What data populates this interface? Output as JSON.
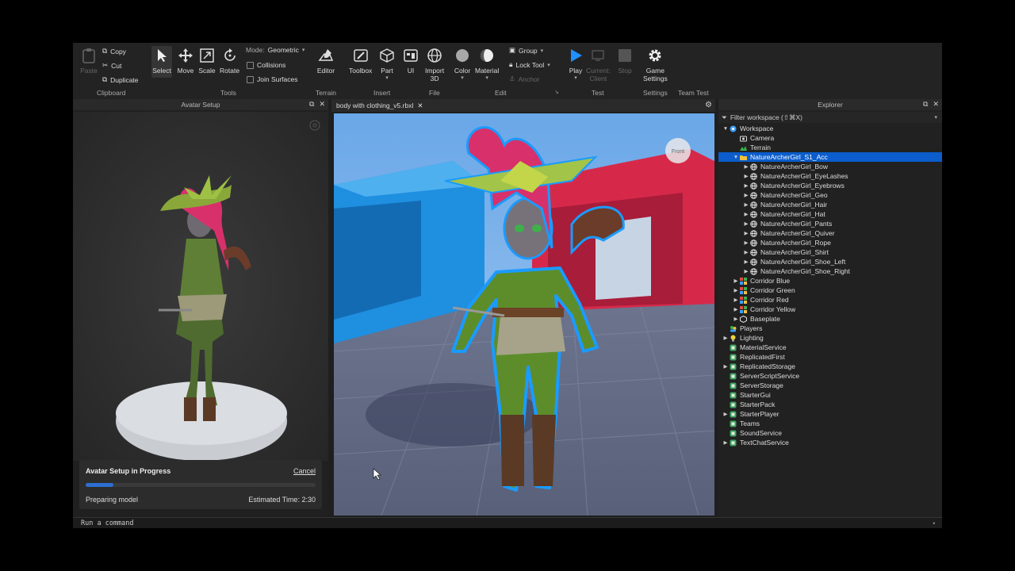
{
  "ribbon": {
    "clipboard": {
      "paste": "Paste",
      "copy": "Copy",
      "cut": "Cut",
      "duplicate": "Duplicate",
      "group": "Clipboard"
    },
    "tools": {
      "select": "Select",
      "move": "Move",
      "scale": "Scale",
      "rotate": "Rotate",
      "mode_label": "Mode:",
      "mode_value": "Geometric",
      "collisions": "Collisions",
      "join_surfaces": "Join Surfaces",
      "group": "Tools"
    },
    "terrain": {
      "editor": "Editor",
      "group": "Terrain"
    },
    "insert": {
      "toolbox": "Toolbox",
      "part": "Part",
      "ui": "UI",
      "group": "Insert"
    },
    "file": {
      "import": "Import",
      "import2": "3D",
      "group": "File"
    },
    "edit": {
      "color": "Color",
      "material": "Material",
      "group_btn": "Group",
      "lock_tool": "Lock Tool",
      "anchor": "Anchor",
      "group": "Edit"
    },
    "test": {
      "play": "Play",
      "current": "Current:",
      "client": "Client",
      "stop": "Stop",
      "group": "Test"
    },
    "settings": {
      "game": "Game",
      "settings": "Settings",
      "group": "Settings"
    },
    "team_test": {
      "group": "Team Test"
    },
    "colors": {
      "accent": "#1e90ff",
      "selection": "#0b5dcb"
    }
  },
  "avatar_setup": {
    "title": "Avatar Setup",
    "progress_title": "Avatar Setup in Progress",
    "cancel": "Cancel",
    "progress": 0.12,
    "status": "Preparing model",
    "eta_label": "Estimated Time:",
    "eta_value": "2:30"
  },
  "viewport": {
    "tab": "body with clothing_v5.rbxl",
    "view_cube": "Front"
  },
  "explorer": {
    "title": "Explorer",
    "filter": "Filter workspace (⇧⌘X)",
    "items": [
      {
        "label": "Workspace",
        "depth": 0,
        "arrow": "down",
        "icon": "workspace"
      },
      {
        "label": "Camera",
        "depth": 1,
        "arrow": "",
        "icon": "camera"
      },
      {
        "label": "Terrain",
        "depth": 1,
        "arrow": "",
        "icon": "terrain"
      },
      {
        "label": "NatureArcherGirl_S1_Acc",
        "depth": 1,
        "arrow": "down",
        "icon": "folder",
        "selected": true
      },
      {
        "label": "NatureArcherGirl_Bow",
        "depth": 2,
        "arrow": "right",
        "icon": "mesh"
      },
      {
        "label": "NatureArcherGirl_EyeLashes",
        "depth": 2,
        "arrow": "right",
        "icon": "mesh"
      },
      {
        "label": "NatureArcherGirl_Eyebrows",
        "depth": 2,
        "arrow": "right",
        "icon": "mesh"
      },
      {
        "label": "NatureArcherGirl_Geo",
        "depth": 2,
        "arrow": "right",
        "icon": "mesh"
      },
      {
        "label": "NatureArcherGirl_Hair",
        "depth": 2,
        "arrow": "right",
        "icon": "mesh"
      },
      {
        "label": "NatureArcherGirl_Hat",
        "depth": 2,
        "arrow": "right",
        "icon": "mesh"
      },
      {
        "label": "NatureArcherGirl_Pants",
        "depth": 2,
        "arrow": "right",
        "icon": "mesh"
      },
      {
        "label": "NatureArcherGirl_Quiver",
        "depth": 2,
        "arrow": "right",
        "icon": "mesh"
      },
      {
        "label": "NatureArcherGirl_Rope",
        "depth": 2,
        "arrow": "right",
        "icon": "mesh"
      },
      {
        "label": "NatureArcherGirl_Shirt",
        "depth": 2,
        "arrow": "right",
        "icon": "mesh"
      },
      {
        "label": "NatureArcherGirl_Shoe_Left",
        "depth": 2,
        "arrow": "right",
        "icon": "mesh"
      },
      {
        "label": "NatureArcherGirl_Shoe_Right",
        "depth": 2,
        "arrow": "right",
        "icon": "mesh"
      },
      {
        "label": "Corridor Blue",
        "depth": 1,
        "arrow": "right",
        "icon": "model"
      },
      {
        "label": "Corridor Green",
        "depth": 1,
        "arrow": "right",
        "icon": "model"
      },
      {
        "label": "Corridor Red",
        "depth": 1,
        "arrow": "right",
        "icon": "model"
      },
      {
        "label": "Corridor Yellow",
        "depth": 1,
        "arrow": "right",
        "icon": "model"
      },
      {
        "label": "Baseplate",
        "depth": 1,
        "arrow": "right",
        "icon": "part"
      },
      {
        "label": "Players",
        "depth": 0,
        "arrow": "",
        "icon": "players"
      },
      {
        "label": "Lighting",
        "depth": 0,
        "arrow": "right",
        "icon": "lighting"
      },
      {
        "label": "MaterialService",
        "depth": 0,
        "arrow": "",
        "icon": "service"
      },
      {
        "label": "ReplicatedFirst",
        "depth": 0,
        "arrow": "",
        "icon": "service"
      },
      {
        "label": "ReplicatedStorage",
        "depth": 0,
        "arrow": "right",
        "icon": "service"
      },
      {
        "label": "ServerScriptService",
        "depth": 0,
        "arrow": "",
        "icon": "service"
      },
      {
        "label": "ServerStorage",
        "depth": 0,
        "arrow": "",
        "icon": "service"
      },
      {
        "label": "StarterGui",
        "depth": 0,
        "arrow": "",
        "icon": "service"
      },
      {
        "label": "StarterPack",
        "depth": 0,
        "arrow": "",
        "icon": "service"
      },
      {
        "label": "StarterPlayer",
        "depth": 0,
        "arrow": "right",
        "icon": "service"
      },
      {
        "label": "Teams",
        "depth": 0,
        "arrow": "",
        "icon": "service"
      },
      {
        "label": "SoundService",
        "depth": 0,
        "arrow": "",
        "icon": "service"
      },
      {
        "label": "TextChatService",
        "depth": 0,
        "arrow": "right",
        "icon": "service"
      }
    ]
  },
  "command_bar": {
    "placeholder": "Run a command"
  }
}
